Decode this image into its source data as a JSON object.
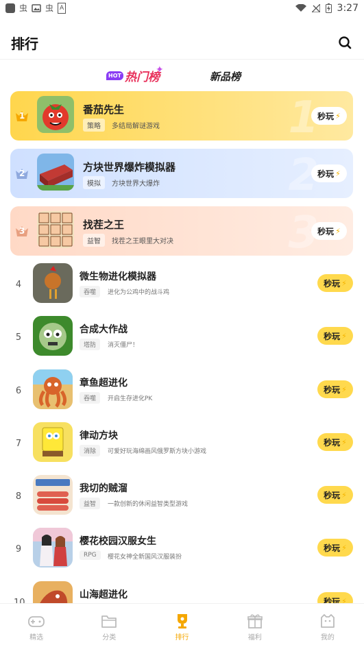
{
  "status_bar": {
    "time": "3:27",
    "left_glyphs": [
      "虫",
      "虫",
      "A"
    ]
  },
  "header": {
    "title": "排行"
  },
  "tabs": {
    "hot_badge": "HOT",
    "hot_label": "热门榜",
    "new_label": "新品榜"
  },
  "play_label": "秒玩",
  "top_games": [
    {
      "rank": "1",
      "name": "番茄先生",
      "tag": "策略",
      "desc": "多结局解谜游戏",
      "bignum": "1"
    },
    {
      "rank": "2",
      "name": "方块世界爆炸模拟器",
      "tag": "模拟",
      "desc": "方块世界大爆炸",
      "bignum": "2"
    },
    {
      "rank": "3",
      "name": "找茬之王",
      "tag": "益智",
      "desc": "找茬之王眼里大对决",
      "bignum": "3"
    }
  ],
  "games": [
    {
      "rank": "4",
      "name": "微生物进化模拟器",
      "tag": "吞噬",
      "desc": "进化为公鸡中的战斗鸡"
    },
    {
      "rank": "5",
      "name": "合成大作战",
      "tag": "塔防",
      "desc": "消灭僵尸！"
    },
    {
      "rank": "6",
      "name": "章鱼超进化",
      "tag": "吞噬",
      "desc": "开启生存进化PK"
    },
    {
      "rank": "7",
      "name": "律动方块",
      "tag": "消除",
      "desc": "可爱好玩海绵画风俄罗斯方块小游戏"
    },
    {
      "rank": "8",
      "name": "我切的贼溜",
      "tag": "益智",
      "desc": "一款创新的休闲益智类型游戏"
    },
    {
      "rank": "9",
      "name": "樱花校园汉服女生",
      "tag": "RPG",
      "desc": "樱花女神全新国风汉服装扮"
    },
    {
      "rank": "10",
      "name": "山海超进化",
      "tag": "",
      "desc": ""
    }
  ],
  "bottom_nav": [
    {
      "label": "精选",
      "icon": "gamepad-icon",
      "active": false
    },
    {
      "label": "分类",
      "icon": "folder-icon",
      "active": false
    },
    {
      "label": "排行",
      "icon": "trophy-icon",
      "active": true
    },
    {
      "label": "福利",
      "icon": "gift-icon",
      "active": false
    },
    {
      "label": "我的",
      "icon": "profile-icon",
      "active": false
    }
  ],
  "colors": {
    "accent": "#f5a700",
    "play_button": "#ffd94d",
    "hot": "#e8315b"
  }
}
